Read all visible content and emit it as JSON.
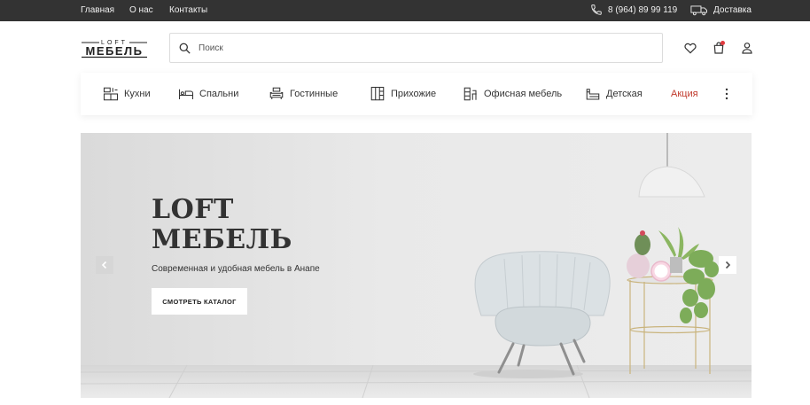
{
  "topbar": {
    "links": [
      "Главная",
      "О нас",
      "Контакты"
    ],
    "phone": "8 (964) 89 99 119",
    "delivery": "Доставка"
  },
  "header": {
    "logo_top": "LOFT",
    "logo_main": "МЕБЕЛЬ",
    "search_placeholder": "Поиск",
    "cart_badge_color": "#e0393e"
  },
  "categories": [
    {
      "label": "Кухни",
      "icon": "kitchen-icon"
    },
    {
      "label": "Спальни",
      "icon": "bed-icon"
    },
    {
      "label": "Гостинные",
      "icon": "sofa-icon"
    },
    {
      "label": "Прихожие",
      "icon": "wardrobe-icon"
    },
    {
      "label": "Офисная мебель",
      "icon": "office-icon"
    },
    {
      "label": "Детская",
      "icon": "kids-icon"
    },
    {
      "label": "Акция",
      "icon": "",
      "color": "#c0392b"
    }
  ],
  "hero": {
    "title_line1": "LOFT",
    "title_line2": "МЕБЕЛЬ",
    "subtitle": "Современная и удобная мебель в Анапе",
    "button": "СМОТРЕТЬ КАТАЛОГ"
  }
}
